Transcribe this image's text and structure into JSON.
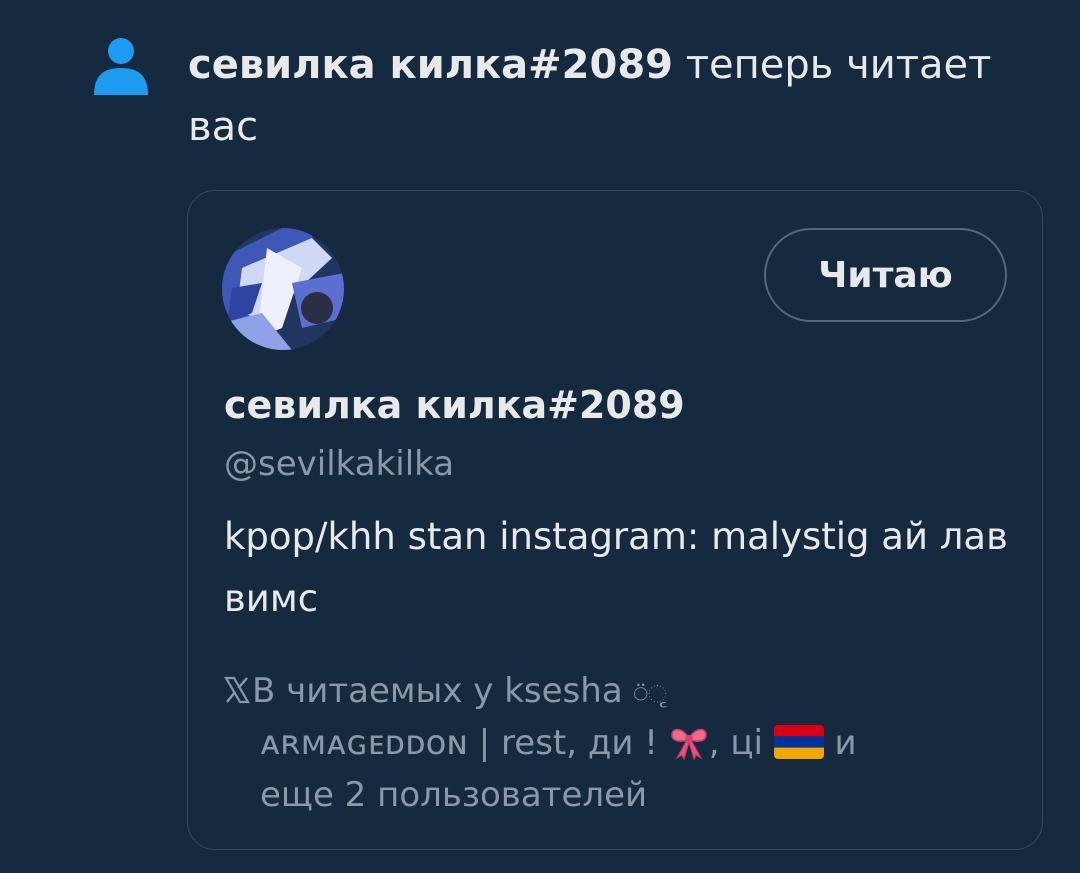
{
  "notification": {
    "icon": "person-icon",
    "icon_color": "#1d9bf0",
    "user_name": "севилка килка#2089",
    "action_text": " теперь читает вас"
  },
  "profile_card": {
    "display_name": "севилка килка#2089",
    "handle": "@sevilkakilka",
    "follow_button_label": "Читаю",
    "bio": "kpop/khh stan instagram: malystig ай лав вимс",
    "followed_by": {
      "prefix": "В читаемых у ",
      "first_user": "ksesha",
      "first_user_decoration": "⍥ૃ",
      "second_user": "ᴀʀᴍᴀɢᴇᴅᴅᴏɴ | rest, ди !",
      "separator_1": ", ",
      "third_user": " цi",
      "conjunction": " и",
      "remainder": "еще 2 пользователей"
    }
  }
}
